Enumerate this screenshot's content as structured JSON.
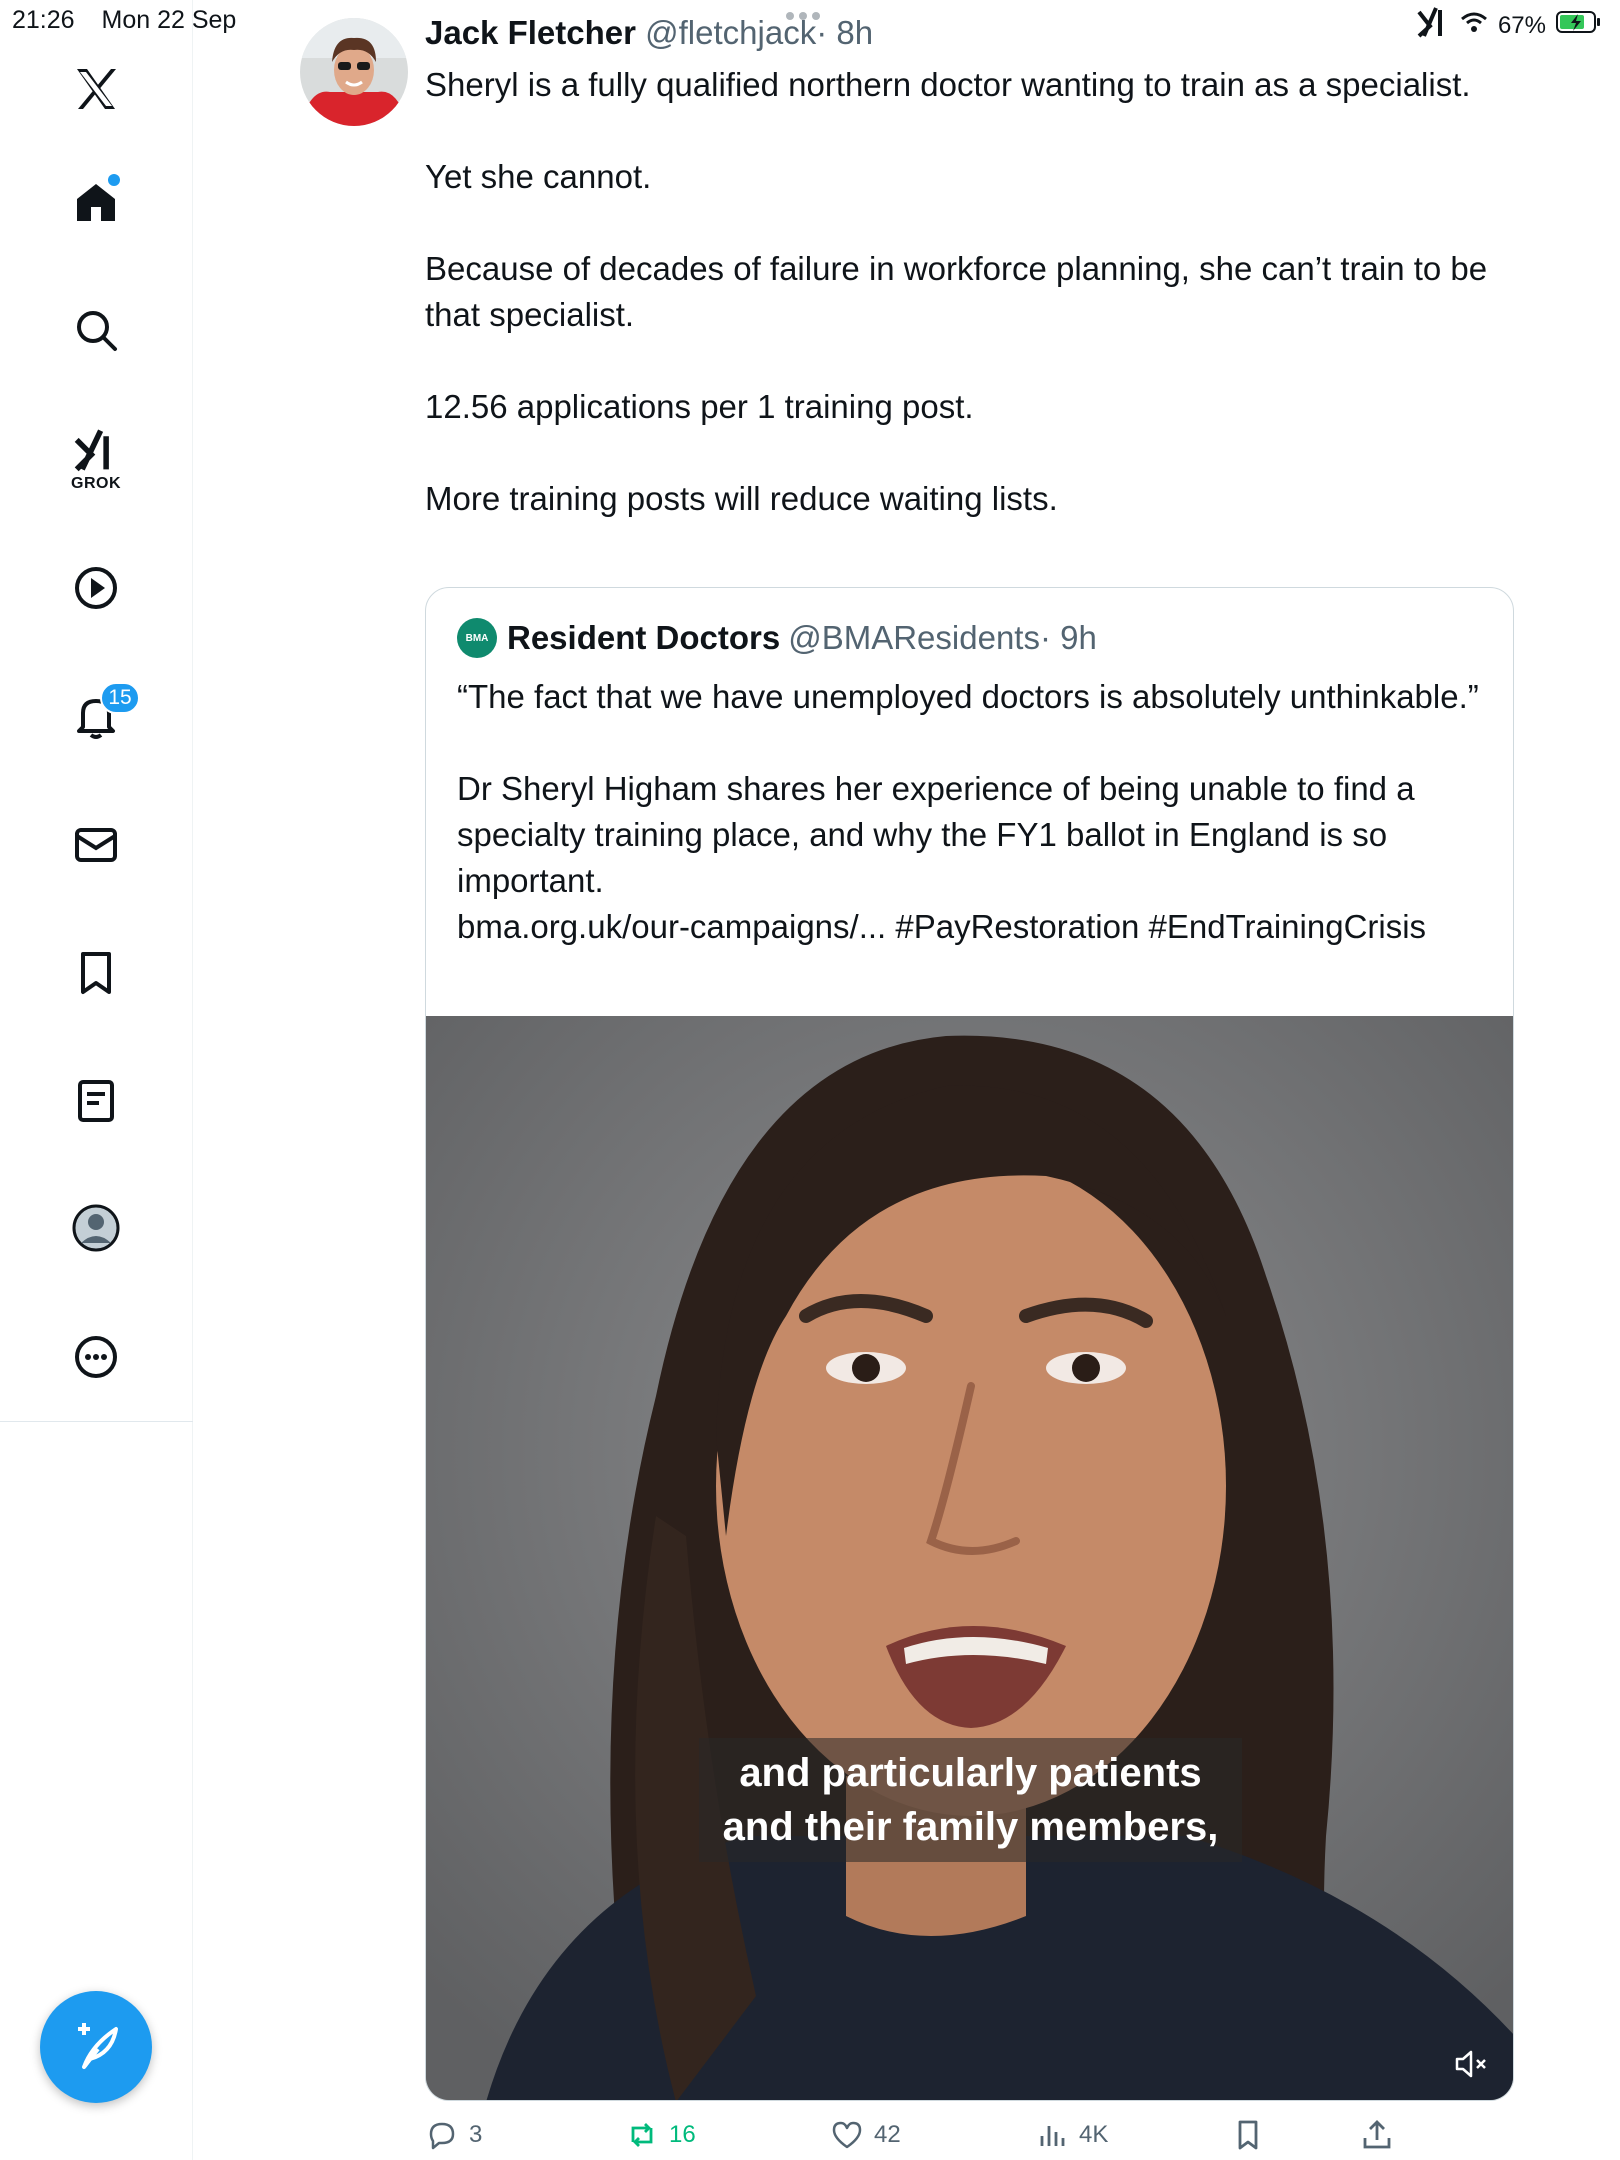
{
  "status_bar": {
    "time": "21:26",
    "date": "Mon 22 Sep",
    "battery": "67%",
    "battery_icon": "battery-charging-icon",
    "wifi_icon": "wifi-icon"
  },
  "sidebar": {
    "items": [
      {
        "name": "x-logo",
        "icon": "x-logo-icon"
      },
      {
        "name": "home",
        "icon": "home-icon",
        "has_dot": true
      },
      {
        "name": "search",
        "icon": "search-icon"
      },
      {
        "name": "grok",
        "icon": "grok-icon",
        "label": "GROK"
      },
      {
        "name": "video",
        "icon": "play-icon"
      },
      {
        "name": "notifications",
        "icon": "bell-icon",
        "badge": "15"
      },
      {
        "name": "messages",
        "icon": "mail-icon"
      },
      {
        "name": "bookmarks",
        "icon": "bookmark-icon"
      },
      {
        "name": "lists",
        "icon": "list-icon"
      },
      {
        "name": "profile",
        "icon": "profile-icon"
      },
      {
        "name": "more",
        "icon": "more-icon"
      }
    ],
    "compose_icon": "compose-icon"
  },
  "tweet": {
    "author_name": "Jack Fletcher",
    "author_handle": "@fletchjack",
    "time": "· 8h",
    "paragraphs": [
      "Sheryl is a fully qualified northern doctor wanting to train as a specialist.",
      "Yet she cannot.",
      "Because of decades of failure in workforce planning, she can’t train to be that specialist.",
      "12.56 applications per 1 training post.",
      "More training posts will reduce waiting lists."
    ]
  },
  "quote": {
    "logo_text": "BMA",
    "author_name": "Resident Doctors",
    "author_handle": "@BMAResidents",
    "time": "· 9h",
    "para1": "“The fact that we have unemployed doctors is absolutely unthinkable.”",
    "para2": "Dr Sheryl Higham shares her experience of being unable to find a specialty training place, and why the FY1 ballot in England is so important.",
    "para3": "bma.org.uk/our-campaigns/... #PayRestoration #EndTrainingCrisis",
    "video": {
      "caption_line1": "and particularly patients",
      "caption_line2": "and their family members,",
      "mute_icon": "muted-speaker-icon"
    }
  },
  "actions": {
    "replies": "3",
    "reposts": "16",
    "likes": "42",
    "views": "4K"
  },
  "colors": {
    "accent": "#1d9bf0",
    "repost": "#00ba7c",
    "secondary_text": "#536471"
  }
}
